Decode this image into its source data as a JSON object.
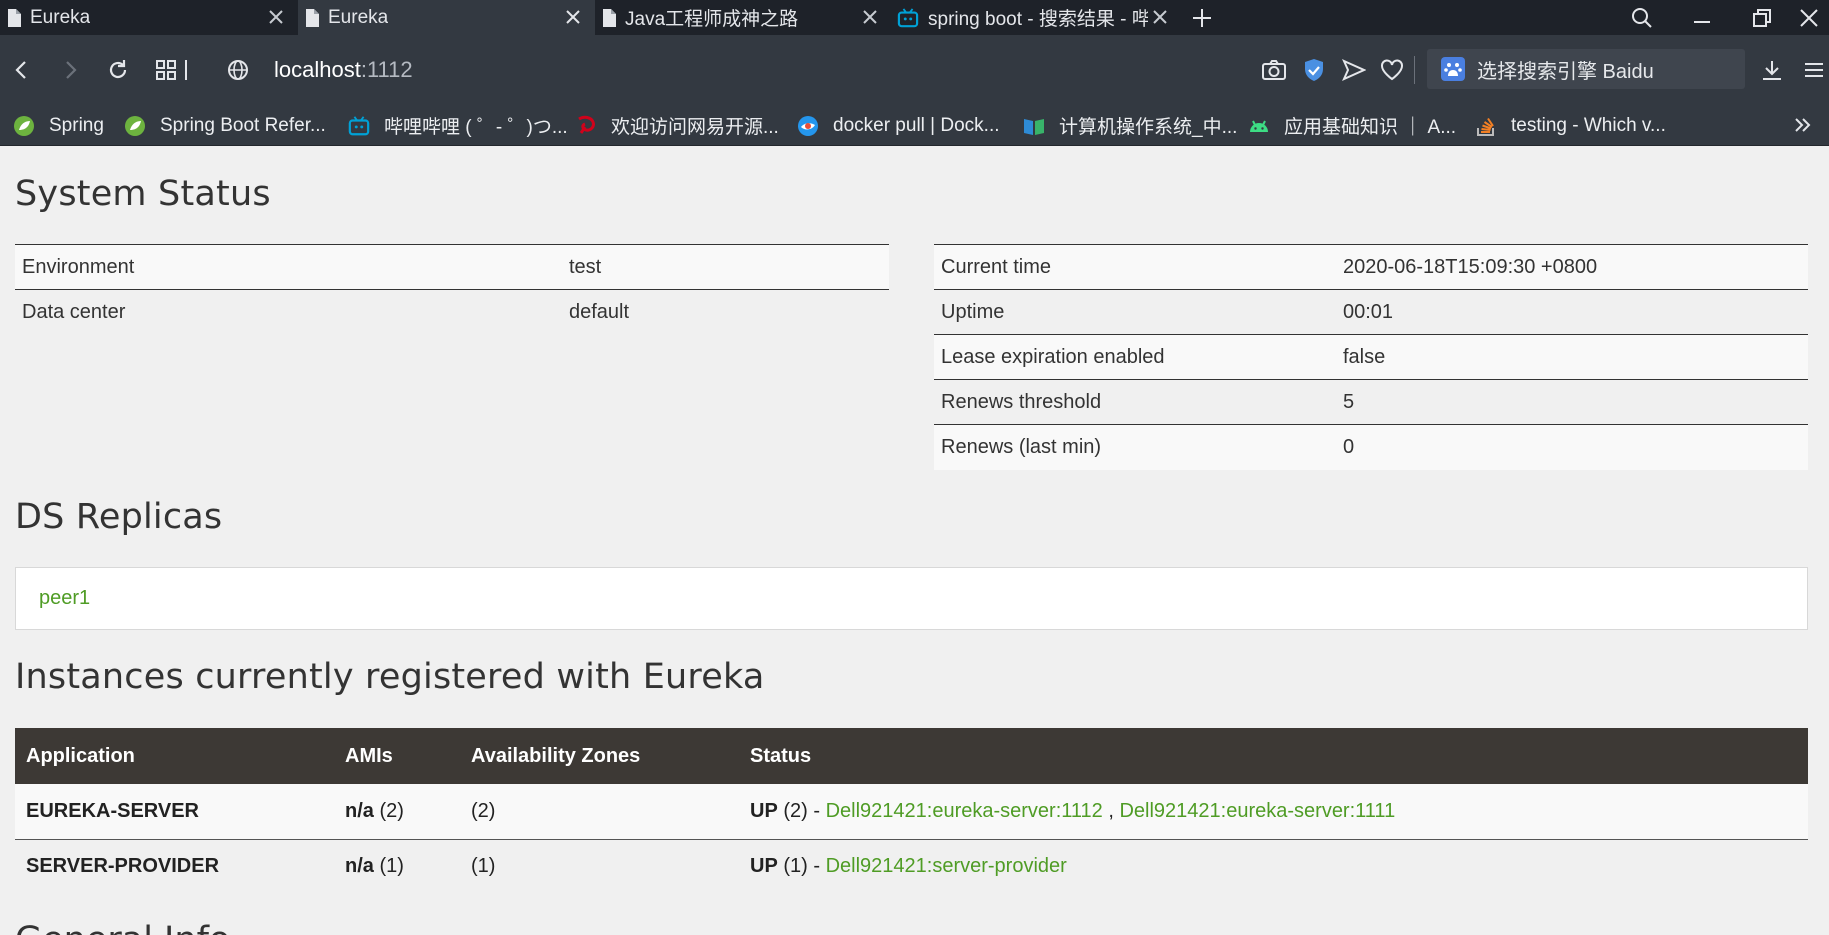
{
  "browser": {
    "tabs": [
      {
        "title": "Eureka",
        "active": false,
        "icon": "page-icon"
      },
      {
        "title": "Eureka",
        "active": true,
        "icon": "page-icon"
      },
      {
        "title": "Java工程师成神之路",
        "active": false,
        "icon": "page-icon"
      },
      {
        "title": "spring boot - 搜索结果 - 哔",
        "active": false,
        "icon": "bilibili-icon"
      }
    ],
    "url_host": "localhost",
    "url_port": ":1112",
    "search_engine_label": "选择搜索引擎 Baidu",
    "bookmarks": [
      {
        "label": "Spring",
        "icon": "spring-icon",
        "color": "#6db33f"
      },
      {
        "label": "Spring Boot Refer...",
        "icon": "spring-icon",
        "color": "#6db33f"
      },
      {
        "label": "哔哩哔哩 ( ゜- ゜)つ...",
        "icon": "bilibili-icon",
        "color": "#00a1d6"
      },
      {
        "label": "欢迎访问网易开源...",
        "icon": "netease-icon",
        "color": "#d0021b"
      },
      {
        "label": "docker pull | Dock...",
        "icon": "docker-icon",
        "color": "#2496ed"
      },
      {
        "label": "计算机操作系统_中...",
        "icon": "book-icon",
        "color": "#2e8bd6"
      },
      {
        "label": "应用基础知识 ｜ A...",
        "icon": "android-icon",
        "color": "#3ddc84"
      },
      {
        "label": "testing - Which v...",
        "icon": "stackoverflow-icon",
        "color": "#f48024"
      }
    ]
  },
  "page": {
    "system_status_title": "System Status",
    "left_status": [
      {
        "label": "Environment",
        "value": "test"
      },
      {
        "label": "Data center",
        "value": "default"
      }
    ],
    "right_status": [
      {
        "label": "Current time",
        "value": "2020-06-18T15:09:30 +0800"
      },
      {
        "label": "Uptime",
        "value": "00:01"
      },
      {
        "label": "Lease expiration enabled",
        "value": "false"
      },
      {
        "label": "Renews threshold",
        "value": "5"
      },
      {
        "label": "Renews (last min)",
        "value": "0"
      }
    ],
    "replicas_title": "DS Replicas",
    "replica_link": "peer1",
    "instances_title": "Instances currently registered with Eureka",
    "instances_headers": [
      "Application",
      "AMIs",
      "Availability Zones",
      "Status"
    ],
    "instances": [
      {
        "application": "EUREKA-SERVER",
        "amis_bold": "n/a",
        "amis_count": " (2)",
        "zones": "(2)",
        "status_prefix": "UP",
        "status_count": " (2) - ",
        "links": [
          "Dell921421:eureka-server:1112",
          "Dell921421:eureka-server:1111"
        ],
        "link_separator": " , "
      },
      {
        "application": "SERVER-PROVIDER",
        "amis_bold": "n/a",
        "amis_count": " (1)",
        "zones": "(1)",
        "status_prefix": "UP",
        "status_count": " (1) - ",
        "links": [
          "Dell921421:server-provider"
        ]
      }
    ],
    "next_section_partial": "General Info"
  },
  "colors": {
    "link_green": "#4f9c25",
    "table_header_bg": "#3d3935",
    "chrome_dark": "#1e2229",
    "chrome_bar": "#333941"
  }
}
